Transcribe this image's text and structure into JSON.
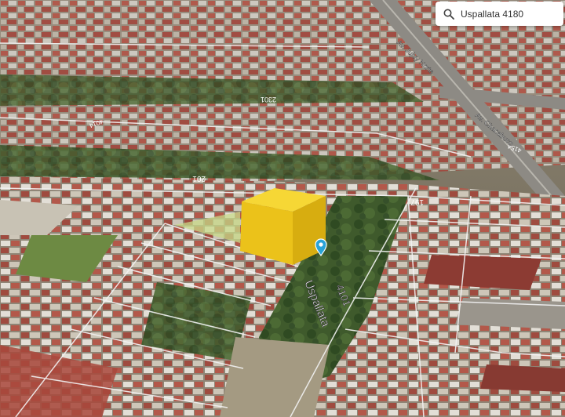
{
  "search": {
    "value": "Uspallata 4180",
    "icon": "search-icon"
  },
  "map": {
    "view": "3D satellite",
    "street_name": "Uspallata",
    "house_number": "4101",
    "marker_icon": "location-pin-icon",
    "selected_parcel_color": "#f2c200",
    "block_numbers": [
      "2301",
      "201",
      "197",
      "4014",
      "4154"
    ],
    "avenue_labels": [
      "Av. Jujuy Norte",
      "Av. Chacabuco"
    ]
  }
}
